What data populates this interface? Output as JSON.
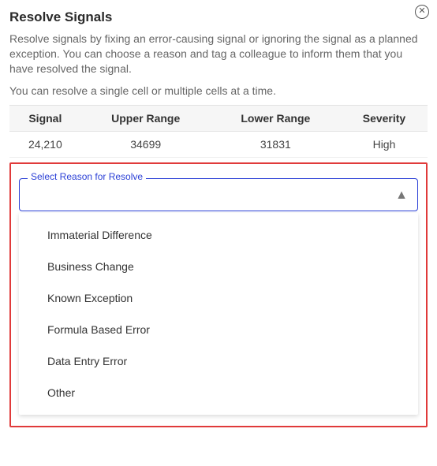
{
  "dialog": {
    "title": "Resolve Signals",
    "description": "Resolve signals by fixing an error-causing signal or ignoring the signal as a planned exception. You can choose a reason and tag a colleague to inform them that you have resolved the signal.",
    "sub_description": "You can resolve a single cell or multiple cells at a time."
  },
  "table": {
    "headers": [
      "Signal",
      "Upper Range",
      "Lower Range",
      "Severity"
    ],
    "rows": [
      {
        "signal": "24,210",
        "upper_range": "34699",
        "lower_range": "31831",
        "severity": "High",
        "severity_class": "high"
      }
    ]
  },
  "select": {
    "label": "Select Reason for Resolve",
    "value": "",
    "options": [
      "Immaterial Difference",
      "Business Change",
      "Known Exception",
      "Formula Based Error",
      "Data Entry Error",
      "Other"
    ]
  },
  "icons": {
    "close": "✕",
    "chevron_up": "▲"
  }
}
